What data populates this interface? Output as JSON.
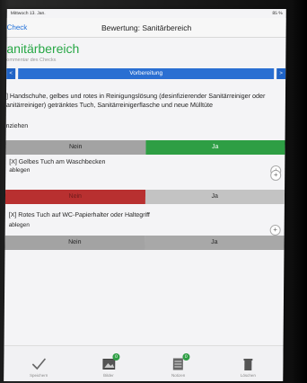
{
  "status": {
    "time": "Mittwoch 13. Jan.",
    "battery": "85 %"
  },
  "nav": {
    "back_label": "Check",
    "title": "Bewertung: Sanitärbereich"
  },
  "section": {
    "title": "anitärbereich",
    "comment_hint": "ommentar des Checks"
  },
  "stepper": {
    "prev": "<",
    "label": "Vorbereitung",
    "next": ">"
  },
  "question1": {
    "text": "] Handschuhe, gelbes und rotes in Reinigungslösung (desinfizierender Sanitärreiniger oder anitärreiniger) getränktes Tuch, Sanitärreinigerflasche und neue Mülltüte",
    "action": "nziehen",
    "no": "Nein",
    "yes": "Ja"
  },
  "question2": {
    "title": "[X] Gelbes Tuch am Waschbecken",
    "action": "ablegen",
    "no": "Nein",
    "yes": "Ja"
  },
  "question3": {
    "title": "[X] Rotes Tuch auf WC-Papierhalter oder Haltegriff",
    "action": "ablegen",
    "no": "Nein",
    "yes": "Ja"
  },
  "tabs": [
    {
      "icon": "checkmark-icon",
      "label": "Speichern",
      "badge": ""
    },
    {
      "icon": "photo-icon",
      "label": "Bilder",
      "badge": "0"
    },
    {
      "icon": "notes-icon",
      "label": "Notizen",
      "badge": "0"
    },
    {
      "icon": "trash-icon",
      "label": "Löschen",
      "badge": ""
    }
  ],
  "colors": {
    "accent": "#2a6fd2",
    "title_green": "#27a745",
    "yes_green": "#2e9e44",
    "no_red": "#b83030"
  }
}
